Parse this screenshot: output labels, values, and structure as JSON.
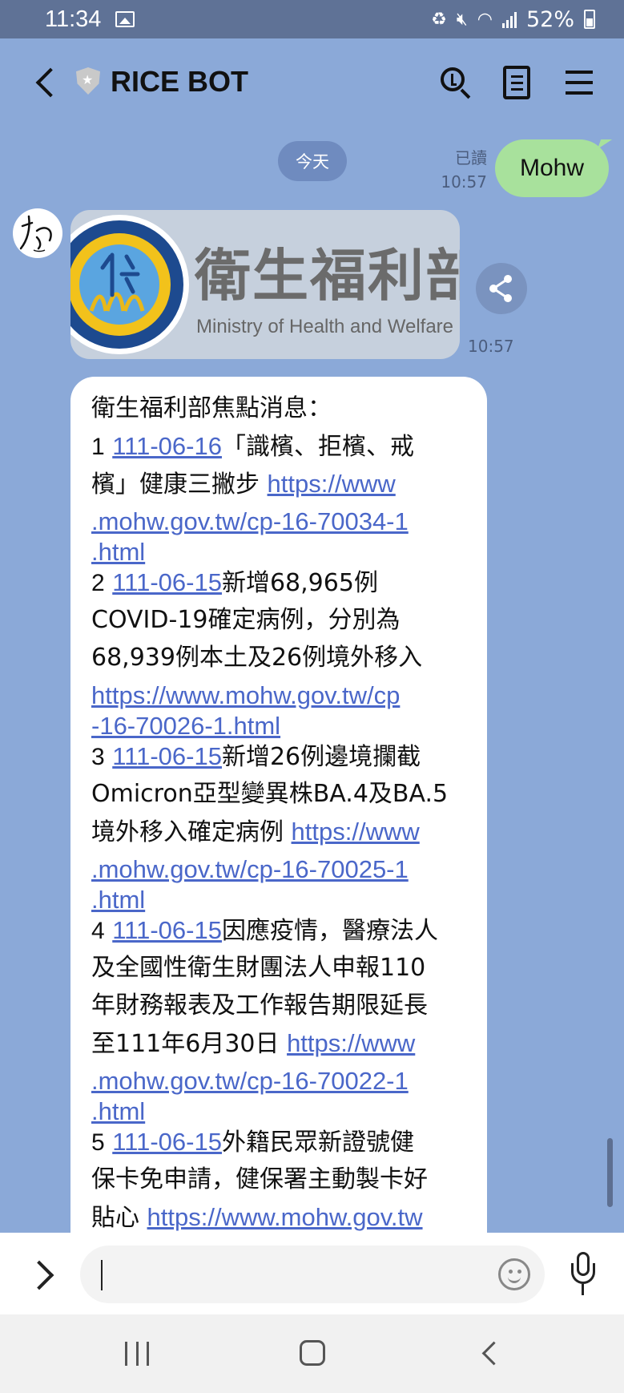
{
  "status_bar": {
    "time": "11:34",
    "battery": "52%"
  },
  "header": {
    "title": "RICE BOT",
    "icons": [
      "back-icon",
      "shield-icon",
      "search-icon",
      "notes-icon",
      "menu-icon"
    ]
  },
  "chat": {
    "date_chip": "今天",
    "my_message": {
      "read_label": "已讀",
      "time": "10:57",
      "text": "Mohw"
    },
    "bot_avatar_text": "な",
    "image_card": {
      "title": "衛生福利部",
      "subtitle": "Ministry of Health and Welfare",
      "logo_ring_text": "Ministry of Health and Welfare",
      "logo_chars": "衛生福利部",
      "time": "10:57"
    },
    "text_message": {
      "heading": "衛生福利部焦點消息：",
      "items": [
        {
          "num": "1",
          "date": "111-06-16",
          "lines": [
            "「識檳、拒檳、戒",
            "檳」健康三撇步 "
          ],
          "url_parts": [
            "https://www",
            ".mohw.gov.tw/cp-16-70034-1",
            ".html"
          ]
        },
        {
          "num": "2",
          "date": "111-06-15",
          "lines": [
            "新增68,965例",
            "COVID-19確定病例，分別為",
            "68,939例本土及26例境外移入"
          ],
          "url_parts": [
            "https://www.mohw.gov.tw/cp",
            "-16-70026-1.html"
          ]
        },
        {
          "num": "3",
          "date": "111-06-15",
          "lines": [
            "新增26例邊境攔截",
            "Omicron亞型變異株BA.4及BA.5",
            "境外移入確定病例 "
          ],
          "url_parts": [
            "https://www",
            ".mohw.gov.tw/cp-16-70025-1",
            ".html"
          ]
        },
        {
          "num": "4",
          "date": "111-06-15",
          "lines": [
            "因應疫情，醫療法人",
            "及全國性衛生財團法人申報110",
            "年財務報表及工作報告期限延長",
            "至111年6月30日 "
          ],
          "url_parts": [
            "https://www",
            ".mohw.gov.tw/cp-16-70022-1",
            ".html"
          ]
        },
        {
          "num": "5",
          "date": "111-06-15",
          "lines": [
            "外籍民眾新證號健",
            "保卡免申請，健保署主動製卡好",
            "貼心 "
          ],
          "url_parts": [
            "https://www.mohw.gov.tw"
          ]
        }
      ]
    }
  },
  "input_bar": {
    "placeholder": "",
    "value": ""
  }
}
